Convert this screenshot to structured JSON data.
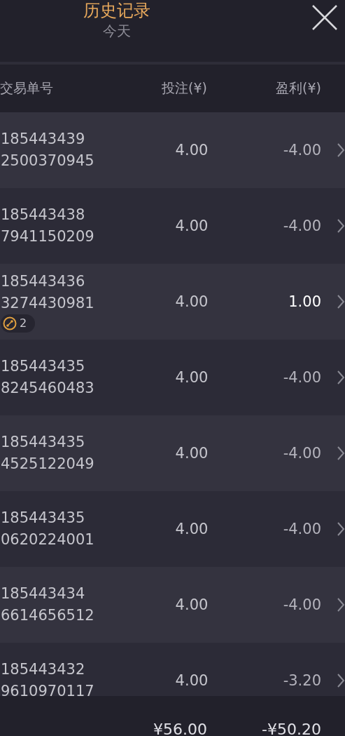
{
  "header": {
    "title": "历史记录",
    "subtitle": "今天"
  },
  "columns": [
    "交易单号",
    "投注(¥)",
    "盈利(¥)"
  ],
  "rows": [
    {
      "id_lines": [
        "185443439",
        "2500370945"
      ],
      "stake": "4.00",
      "profit": "-4.00",
      "won": false
    },
    {
      "id_lines": [
        "185443438",
        "7941150209"
      ],
      "stake": "4.00",
      "profit": "-4.00",
      "won": false
    },
    {
      "id_lines": [
        "185443436",
        "3274430981"
      ],
      "badge": "2",
      "stake": "4.00",
      "profit": "1.00",
      "won": true
    },
    {
      "id_lines": [
        "185443435",
        "8245460483"
      ],
      "stake": "4.00",
      "profit": "-4.00",
      "won": false
    },
    {
      "id_lines": [
        "185443435",
        "4525122049"
      ],
      "stake": "4.00",
      "profit": "-4.00",
      "won": false
    },
    {
      "id_lines": [
        "185443435",
        "0620224001"
      ],
      "stake": "4.00",
      "profit": "-4.00",
      "won": false
    },
    {
      "id_lines": [
        "185443434",
        "6614656512"
      ],
      "stake": "4.00",
      "profit": "-4.00",
      "won": false
    },
    {
      "id_lines": [
        "185443432",
        "9610970117"
      ],
      "stake": "4.00",
      "profit": "-3.20",
      "won": false
    }
  ],
  "totals": {
    "stake": "¥56.00",
    "profit": "-¥50.20"
  }
}
